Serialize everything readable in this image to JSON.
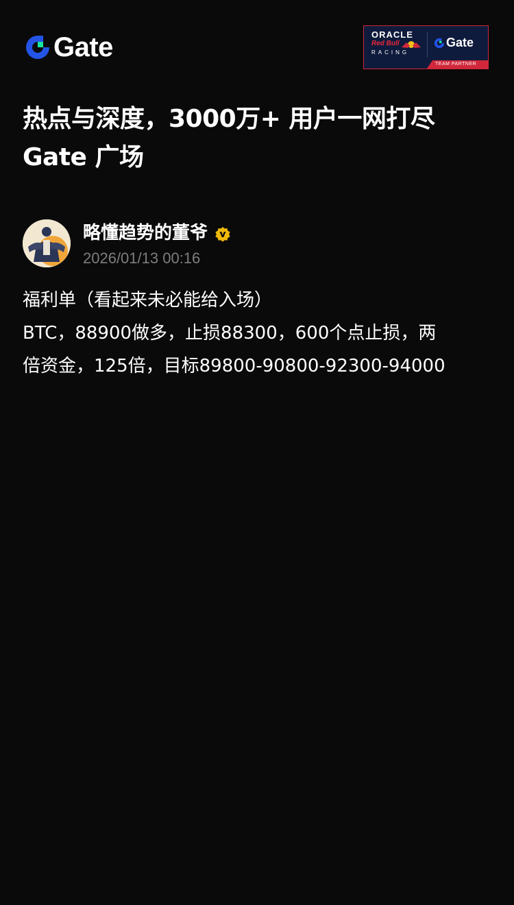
{
  "header": {
    "brand_name": "Gate",
    "partner": {
      "oracle": "ORACLE",
      "redbull": "Red Bull",
      "racing": "RACING",
      "gate": "Gate",
      "team_partner": "TEAM PARTNER"
    }
  },
  "headline": {
    "line1": "热点与深度，3000万+ 用户一网打尽",
    "line2": "Gate 广场"
  },
  "post": {
    "author_name": "略懂趋势的董爷",
    "timestamp": "2026/01/13 00:16",
    "lines": [
      "福利单（看起来未必能给入场）",
      "BTC，88900做多，止损88300，600个点止损，两",
      "倍资金，125倍，目标89800-90800-92300-94000"
    ]
  },
  "colors": {
    "background": "#0a0a0a",
    "brand_blue": "#2354e6",
    "brand_green": "#17e6a1",
    "verified_gold": "#f0b90b",
    "muted_text": "#7d7d7d",
    "partner_navy": "#0f1b3d",
    "partner_red": "#d0283a"
  },
  "icons": {
    "brand_logo": "gate-logo-icon",
    "verified": "verified-badge-icon",
    "avatar": "avatar-image"
  }
}
